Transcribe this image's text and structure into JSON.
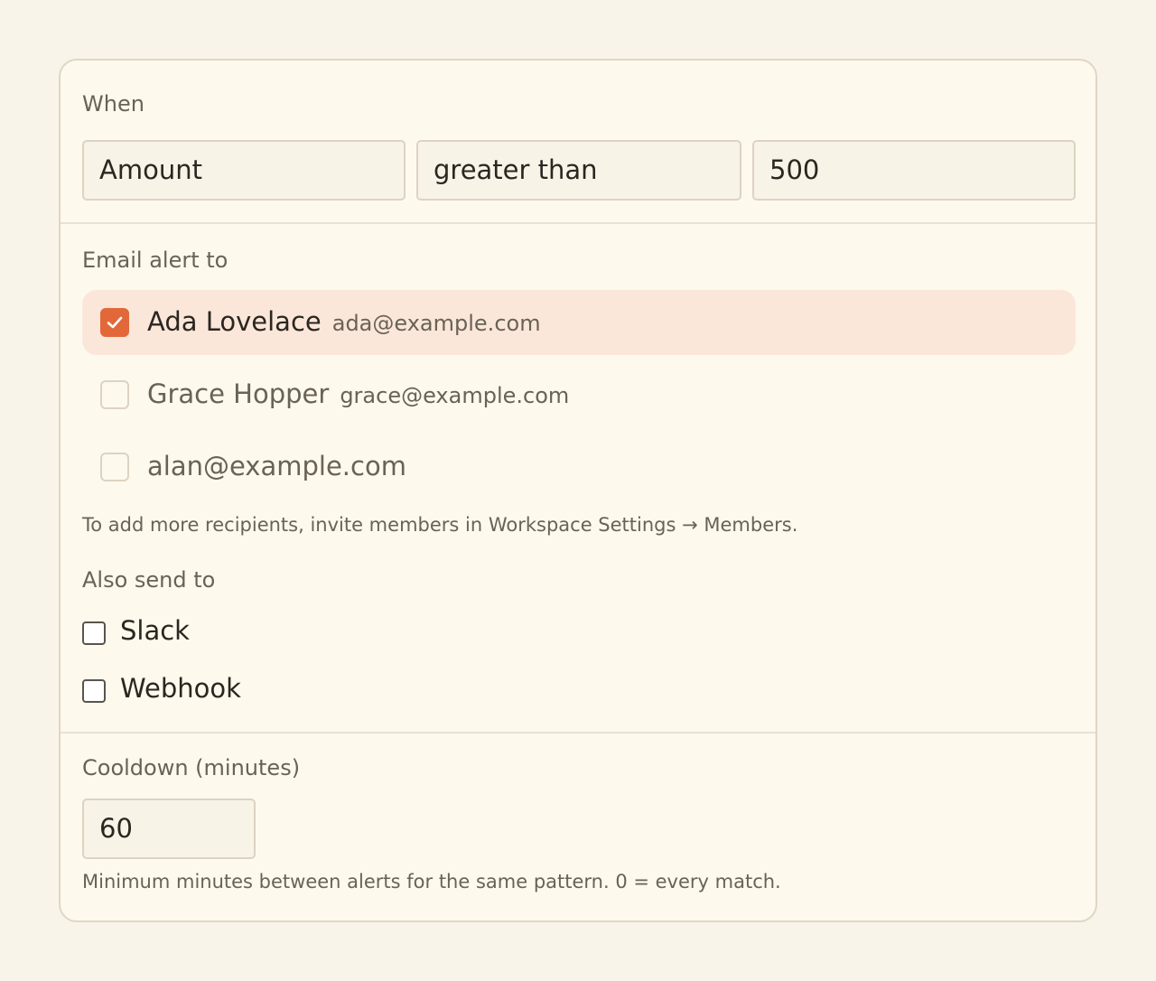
{
  "when": {
    "label": "When",
    "field": "Amount",
    "operator": "greater than",
    "value": "500"
  },
  "email": {
    "label": "Email alert to",
    "recipients": [
      {
        "name": "Ada Lovelace",
        "email": "ada@example.com",
        "checked": true
      },
      {
        "name": "Grace Hopper",
        "email": "grace@example.com",
        "checked": false
      },
      {
        "name": "",
        "email": "alan@example.com",
        "checked": false
      }
    ],
    "help": "To add more recipients, invite members in Workspace Settings → Members.",
    "also_label": "Also send to",
    "channels": [
      {
        "label": "Slack",
        "checked": false
      },
      {
        "label": "Webhook",
        "checked": false
      }
    ]
  },
  "cooldown": {
    "label": "Cooldown (minutes)",
    "value": "60",
    "help": "Minimum minutes between alerts for the same pattern. 0 = every match."
  },
  "colors": {
    "accent": "#e2683a",
    "selected_row": "#fbe7da",
    "background": "#f9f4e9",
    "card": "#fdf9ed"
  },
  "icons": {
    "check": "checkmark-icon"
  }
}
